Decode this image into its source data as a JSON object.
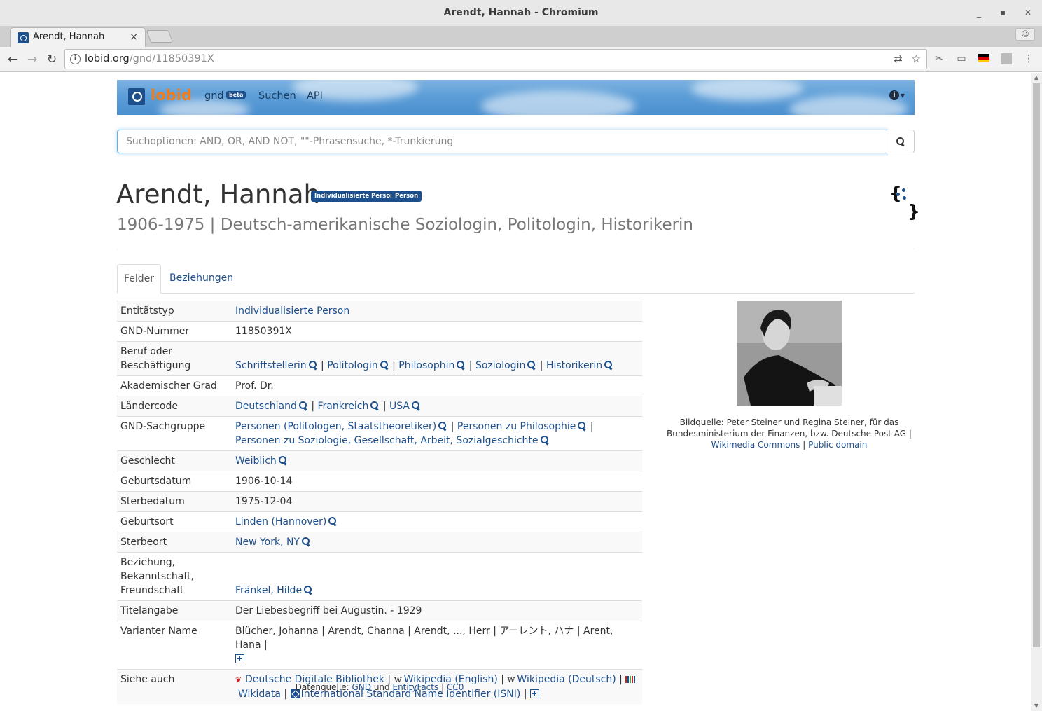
{
  "window": {
    "title": "Arendt, Hannah - Chromium"
  },
  "tab": {
    "title": "Arendt, Hannah",
    "close": "×"
  },
  "address": {
    "host": "lobid.org",
    "path": "/gnd/11850391X"
  },
  "nav": {
    "logo": "lobid",
    "gnd": "gnd",
    "beta": "beta",
    "search": "Suchen",
    "api": "API"
  },
  "search": {
    "placeholder": "Suchoptionen: AND, OR, AND NOT, \"\"-Phrasensuche, *-Trunkierung"
  },
  "heading": {
    "title": "Arendt, Hannah",
    "badges": [
      "Individualisierte Person",
      "Person"
    ],
    "subtitle": "1906-1975 | Deutsch-amerikanische Soziologin, Politologin, Historikerin"
  },
  "tabs": {
    "active": "Felder",
    "other": "Beziehungen"
  },
  "fields": {
    "entity_type": {
      "label": "Entitätstyp",
      "value": "Individualisierte Person"
    },
    "gnd_number": {
      "label": "GND-Nummer",
      "value": "11850391X"
    },
    "profession": {
      "label": "Beruf oder Beschäftigung",
      "values": [
        "Schriftstellerin",
        "Politologin",
        "Philosophin",
        "Soziologin",
        "Historikerin"
      ]
    },
    "degree": {
      "label": "Akademischer Grad",
      "value": "Prof. Dr."
    },
    "country": {
      "label": "Ländercode",
      "values": [
        "Deutschland",
        "Frankreich",
        "USA"
      ]
    },
    "subject": {
      "label": "GND-Sachgruppe",
      "values": [
        "Personen (Politologen, Staatstheoretiker)",
        "Personen zu Philosophie",
        "Personen zu Soziologie, Gesellschaft, Arbeit, Sozialgeschichte"
      ]
    },
    "gender": {
      "label": "Geschlecht",
      "value": "Weiblich"
    },
    "birth_date": {
      "label": "Geburtsdatum",
      "value": "1906-10-14"
    },
    "death_date": {
      "label": "Sterbedatum",
      "value": "1975-12-04"
    },
    "birth_place": {
      "label": "Geburtsort",
      "value": "Linden (Hannover)"
    },
    "death_place": {
      "label": "Sterbeort",
      "value": "New York, NY"
    },
    "relation": {
      "label": "Beziehung, Bekanntschaft, Freundschaft",
      "value": "Fränkel, Hilde"
    },
    "title_info": {
      "label": "Titelangabe",
      "value": "Der Liebesbegriff bei Augustin. - 1929"
    },
    "variant_names": {
      "label": "Varianter Name",
      "values": [
        "Blücher, Johanna",
        "Arendt, Channa",
        "Arendt, ..., Herr",
        "アーレント, ハナ",
        "Arent, Hana"
      ]
    },
    "see_also": {
      "label": "Siehe auch",
      "values": [
        "Deutsche Digitale Bibliothek",
        "Wikipedia (English)",
        "Wikipedia (Deutsch)",
        "Wikidata",
        "International Standard Name Identifier (ISNI)"
      ]
    }
  },
  "image_caption": {
    "text": "Bildquelle: Peter Steiner und Regina Steiner, für das Bundesministerium der Finanzen, bzw. Deutsche Post AG |",
    "link1": "Wikimedia Commons",
    "link2": "Public domain"
  },
  "footer": {
    "prefix": "Datenquelle:",
    "gnd": "GND",
    "und": "und",
    "entityfacts": "EntityFacts",
    "license": "CC0"
  },
  "colors": {
    "link": "#1d4f8c",
    "accent_orange": "#f07d1a",
    "badge": "#1d4f8c"
  }
}
